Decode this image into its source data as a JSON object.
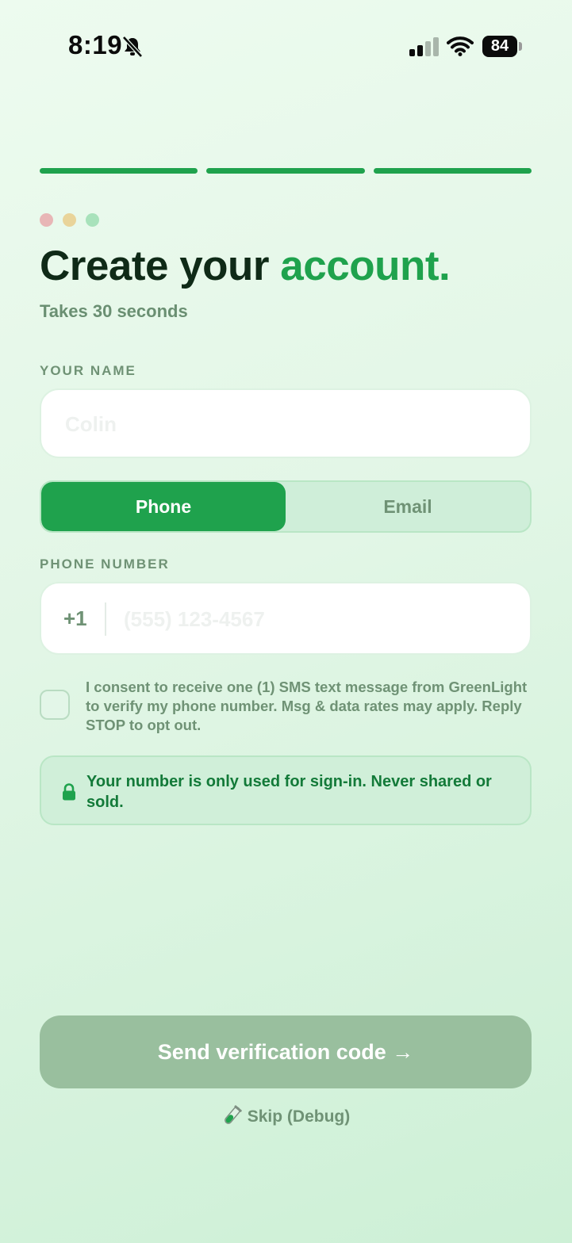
{
  "status_bar": {
    "time": "8:19",
    "battery": "84",
    "icons": [
      "bell-slash-icon",
      "cellular-signal-icon",
      "wifi-icon",
      "battery-icon"
    ]
  },
  "progress": {
    "total_steps": 3,
    "completed_steps": 3,
    "color": "#1fa24d"
  },
  "decorative_dots": [
    "#e8b6b6",
    "#e9d49a",
    "#a8e2bb"
  ],
  "header": {
    "title_main": "Create your ",
    "title_accent": "account.",
    "subtitle": "Takes 30 seconds"
  },
  "name_field": {
    "label": "YOUR NAME",
    "value": "",
    "placeholder": "Colin"
  },
  "contact_method": {
    "options": [
      "Phone",
      "Email"
    ],
    "selected": "Phone"
  },
  "phone_field": {
    "label": "PHONE NUMBER",
    "country_code": "+1",
    "value": "",
    "placeholder": "(555) 123-4567"
  },
  "consent": {
    "checked": false,
    "text": "I consent to receive one (1) SMS text message from GreenLight to verify my phone number. Msg & data rates may apply. Reply STOP to opt out."
  },
  "privacy_notice": {
    "icon": "lock-icon",
    "text": "Your number is only used for sign-in. Never shared or sold."
  },
  "actions": {
    "send_label": "Send verification code →",
    "skip_label": "Skip (Debug)",
    "skip_icon": "test-tube-icon"
  },
  "colors": {
    "accent": "#1fa24d",
    "accent_dark": "#137a39",
    "muted_text": "#6f9275",
    "disabled_button": "#99bf9e"
  }
}
